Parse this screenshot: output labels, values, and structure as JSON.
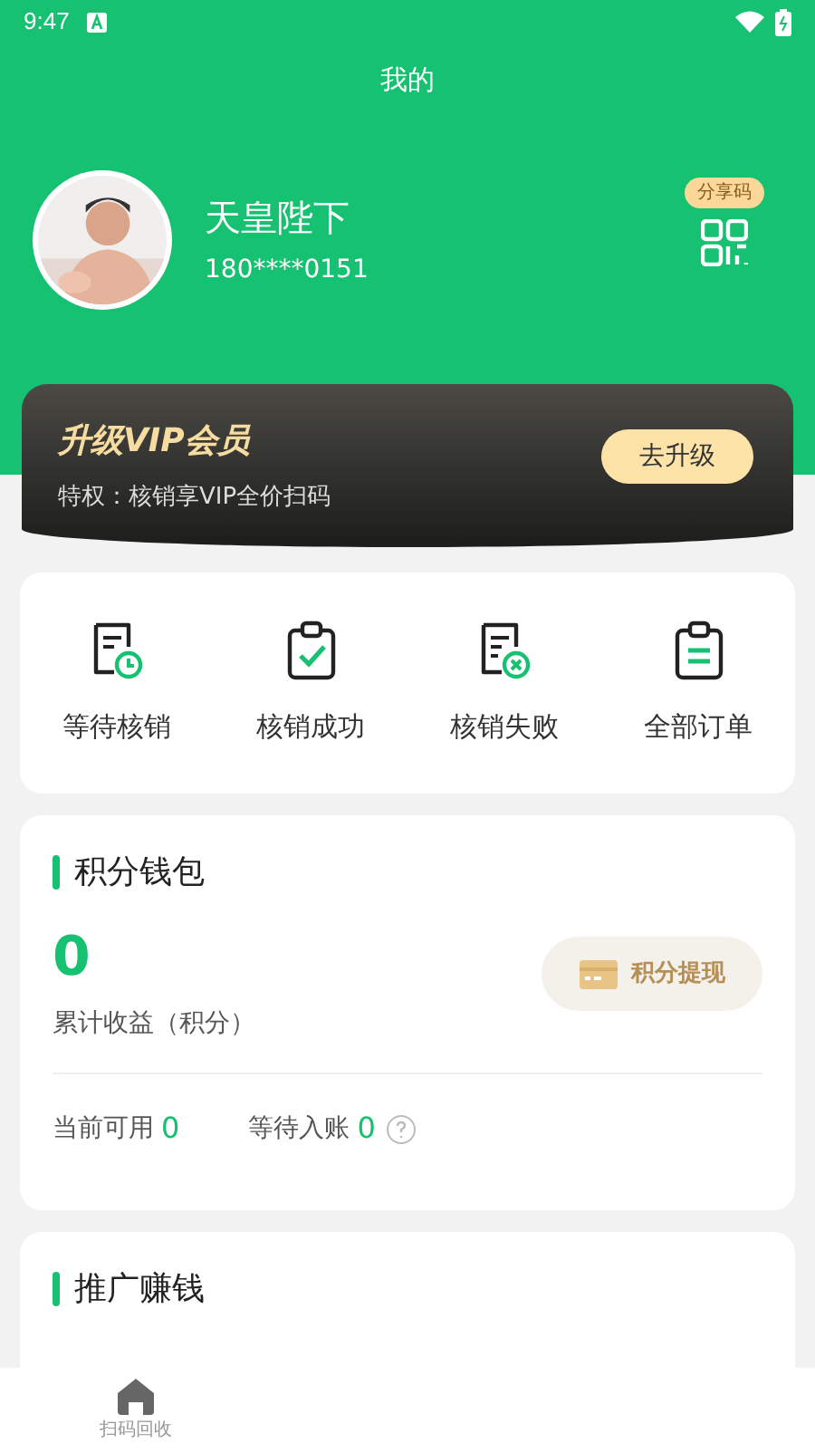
{
  "status_bar": {
    "time": "9:47"
  },
  "header": {
    "title": "我的"
  },
  "profile": {
    "name": "天皇陛下",
    "phone": "180****0151",
    "share_badge": "分享码"
  },
  "vip_banner": {
    "title": "升级VIP会员",
    "subtitle": "特权：核销享VIP全价扫码",
    "button": "去升级"
  },
  "orders": [
    {
      "kind": "pending",
      "label": "等待核销"
    },
    {
      "kind": "success",
      "label": "核销成功"
    },
    {
      "kind": "failed",
      "label": "核销失败"
    },
    {
      "kind": "all",
      "label": "全部订单"
    }
  ],
  "wallet": {
    "title": "积分钱包",
    "total": "0",
    "total_label": "累计收益（积分）",
    "withdraw_button": "积分提现",
    "available_label": "当前可用",
    "available": "0",
    "pending_label": "等待入账",
    "pending": "0"
  },
  "promotion": {
    "title": "推广赚钱"
  },
  "bottom_nav": [
    {
      "label": "扫码回收"
    }
  ]
}
